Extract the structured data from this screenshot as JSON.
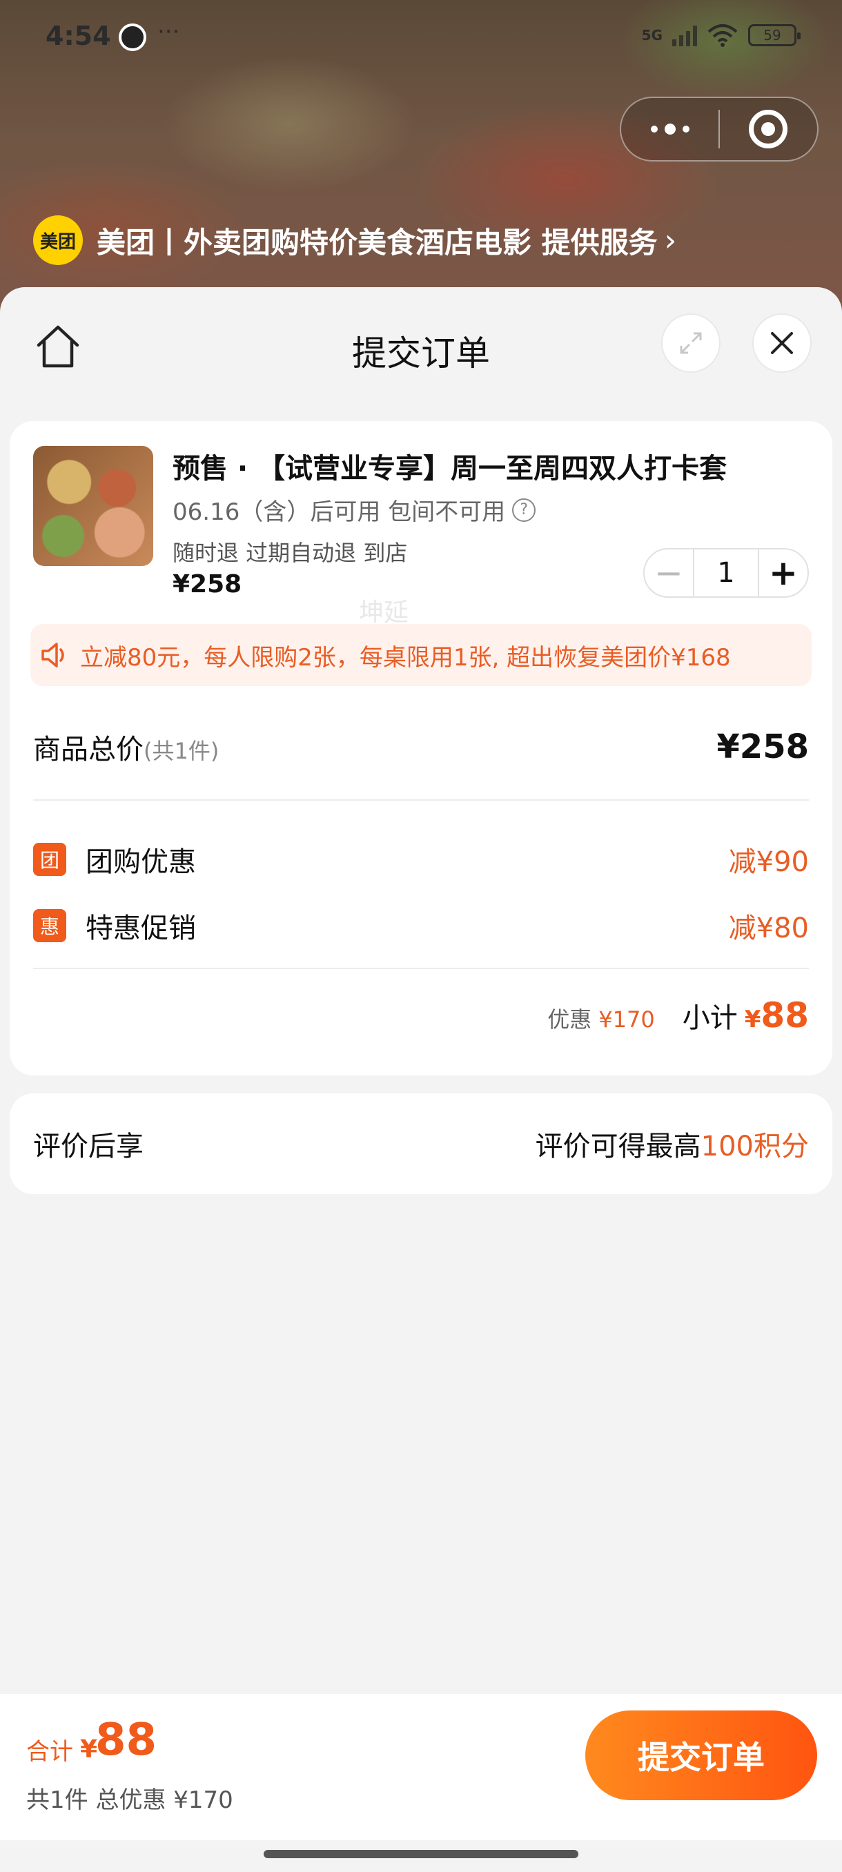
{
  "status_bar": {
    "time": "4:54",
    "more_dots": "···",
    "network": "5G",
    "battery": "59"
  },
  "provider": {
    "logo_text": "美团",
    "label": "美团丨外卖团购特价美食酒店电影 提供服务",
    "chevron": "›"
  },
  "nav": {
    "title": "提交订单"
  },
  "product": {
    "name": "预售 · 【试营业专享】周一至周四双人打卡套",
    "availability": "06.16（含）后可用 包间不可用",
    "help_icon": "?",
    "tags": "随时退 过期自动退 到店",
    "price": "¥258",
    "quantity": "1",
    "minus": "−",
    "plus": "+"
  },
  "notice": {
    "text": "立减80元，每人限购2张，每桌限用1张, 超出恢复美团价¥168"
  },
  "totals": {
    "label": "商品总价",
    "count": "(共1件)",
    "price": "¥258"
  },
  "discounts": [
    {
      "badge": "团",
      "label": "团购优惠",
      "amount": "减¥90"
    },
    {
      "badge": "惠",
      "label": "特惠促销",
      "amount": "减¥80"
    }
  ],
  "watermark": "坤延",
  "subtotal": {
    "discount_label": "优惠",
    "discount_value": "¥170",
    "label": "小计",
    "yen": "¥",
    "value": "88"
  },
  "review": {
    "left": "评价后享",
    "right_prefix": "评价可得最高",
    "right_points": "100积分"
  },
  "bottom_bar": {
    "total_label": "合计",
    "yen": "¥",
    "amount": "88",
    "summary": "共1件 总优惠 ¥170",
    "submit": "提交订单"
  },
  "colors": {
    "accent": "#f05a1a",
    "discount_text": "#e85d24",
    "notice_bg": "#fff1ec",
    "logo_yellow": "#ffd100"
  },
  "icons": [
    "home-icon",
    "expand-icon",
    "close-icon",
    "speaker-icon",
    "help-icon",
    "minus-icon",
    "plus-icon",
    "wifi-icon",
    "battery-icon"
  ]
}
